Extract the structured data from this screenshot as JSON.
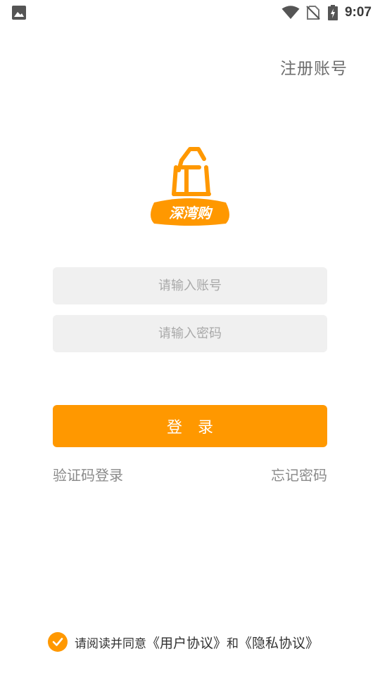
{
  "status_bar": {
    "time": "9:07",
    "icons": [
      "gallery-icon",
      "wifi-icon",
      "no-sim-icon",
      "battery-charging-icon"
    ]
  },
  "header": {
    "register_label": "注册账号"
  },
  "logo": {
    "text": "深湾购",
    "color": "#ff9800"
  },
  "form": {
    "account_placeholder": "请输入账号",
    "password_placeholder": "请输入密码",
    "login_label": "登　录",
    "sms_login_label": "验证码登录",
    "forgot_label": "忘记密码"
  },
  "agreement": {
    "checked": true,
    "prefix": "请阅读并同意",
    "user_agreement": "《用户协议》",
    "and": "和",
    "privacy_agreement": "《隐私协议》"
  },
  "colors": {
    "accent": "#ff9800",
    "input_bg": "#f0f0f0",
    "muted_text": "#8a8a8a"
  }
}
